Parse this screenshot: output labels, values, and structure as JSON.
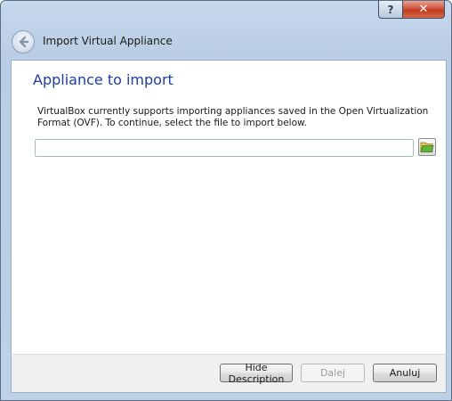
{
  "window": {
    "title": "Import Virtual Appliance",
    "help_glyph": "?",
    "close_glyph": "✕"
  },
  "page": {
    "heading": "Appliance to import",
    "description": "VirtualBox currently supports importing appliances saved in the Open Virtualization Format (OVF). To continue, select the file to import below."
  },
  "file_input": {
    "value": "",
    "placeholder": ""
  },
  "buttons": {
    "hide_description": "Hide Description",
    "next": "Dalej",
    "cancel": "Anuluj"
  },
  "icons": {
    "back": "back-arrow-icon",
    "browse": "folder-open-icon"
  }
}
